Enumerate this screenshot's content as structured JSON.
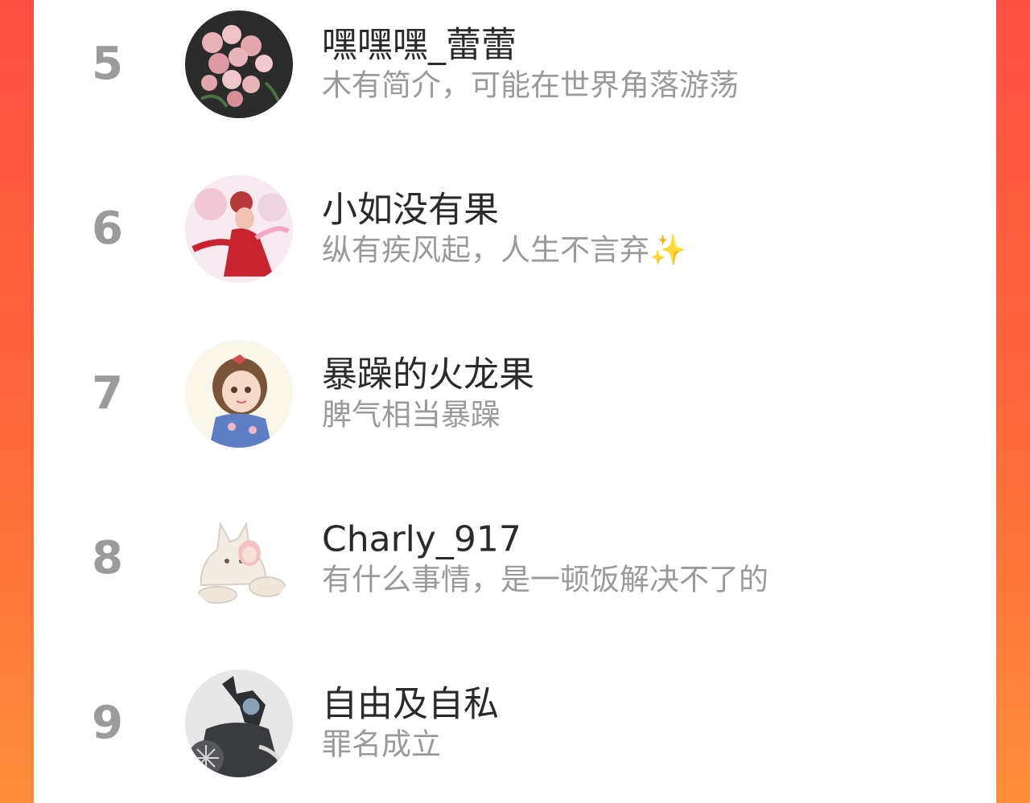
{
  "leaderboard": {
    "entries": [
      {
        "rank": "5",
        "name": "嘿嘿嘿_蕾蕾",
        "bio": "木有简介，可能在世界角落游荡",
        "avatar_icon": "roses-photo-avatar-icon"
      },
      {
        "rank": "6",
        "name": "小如没有果",
        "bio": "纵有疾风起，人生不言弃✨",
        "avatar_icon": "dancer-portrait-avatar-icon"
      },
      {
        "rank": "7",
        "name": "暴躁的火龙果",
        "bio": "脾气相当暴躁",
        "avatar_icon": "anime-girl-avatar-icon"
      },
      {
        "rank": "8",
        "name": "Charly_917",
        "bio": "有什么事情，是一顿饭解决不了的",
        "avatar_icon": "fox-and-girl-avatar-icon"
      },
      {
        "rank": "9",
        "name": "自由及自私",
        "bio": "罪名成立",
        "avatar_icon": "dark-figure-avatar-icon"
      }
    ]
  },
  "colors": {
    "background_gradient_start": "#ff4f45",
    "background_gradient_end": "#ff8d3c",
    "rank_text": "#9b9b9b",
    "name_text": "#2a2a2a",
    "bio_text": "#9a9a9a"
  }
}
